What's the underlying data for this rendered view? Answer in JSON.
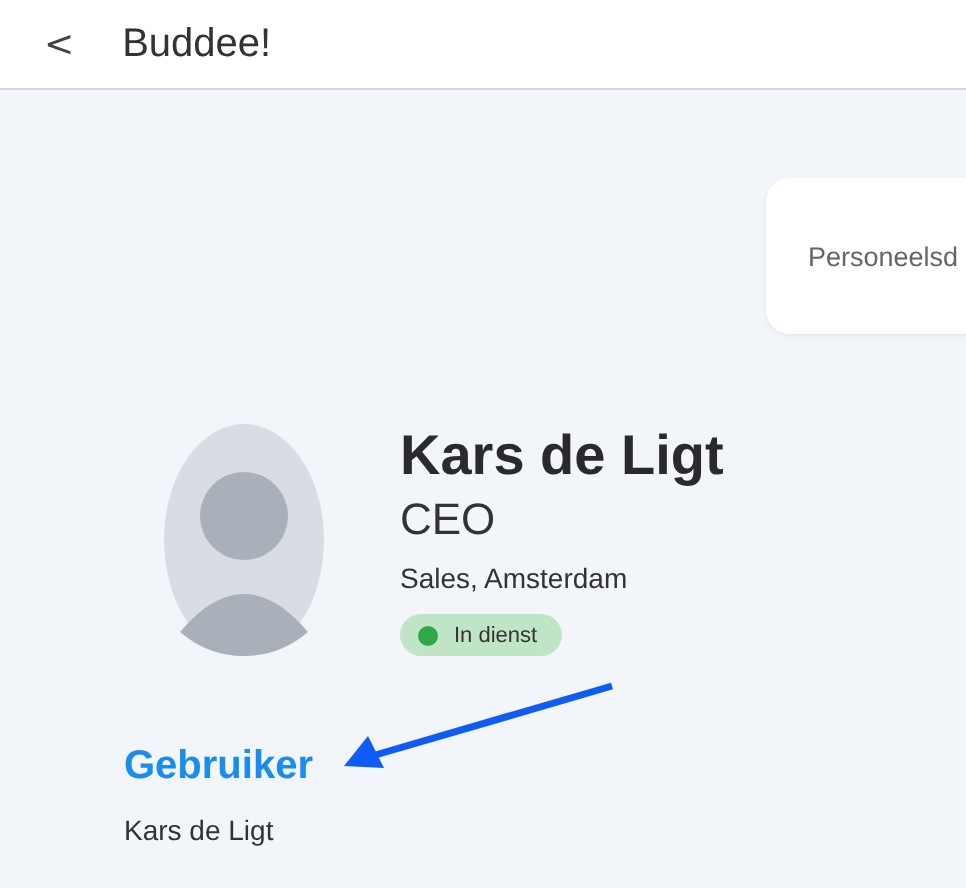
{
  "header": {
    "back": "<",
    "title": "Buddee!"
  },
  "card": {
    "label": "Personeelsd"
  },
  "profile": {
    "name": "Kars de Ligt",
    "role": "CEO",
    "location": "Sales, Amsterdam",
    "status": {
      "label": "In dienst",
      "kind": "active"
    }
  },
  "section": {
    "title": "Gebruiker",
    "value": "Kars de Ligt"
  }
}
